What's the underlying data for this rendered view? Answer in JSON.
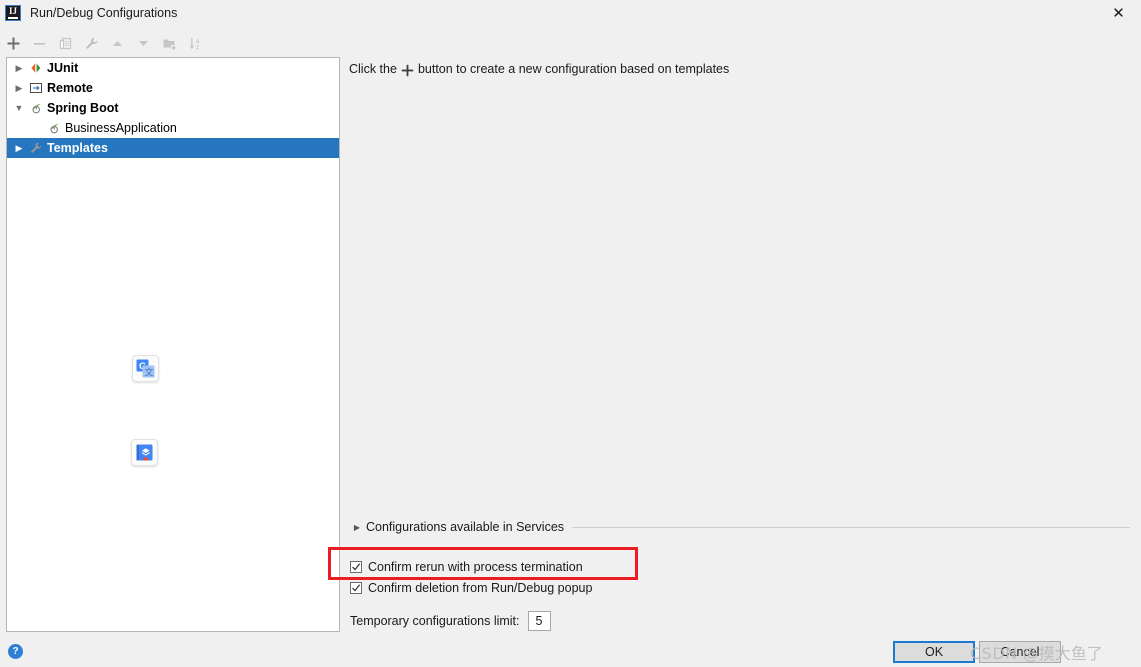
{
  "window": {
    "title": "Run/Debug Configurations",
    "app_icon": "intellij-idea-icon",
    "close_icon": "✕"
  },
  "toolbar": {
    "buttons": [
      {
        "name": "add-configuration-button",
        "icon": "plus-icon",
        "label": "Add New Configuration"
      },
      {
        "name": "remove-configuration-button",
        "icon": "minus-icon",
        "label": "Remove Configuration"
      },
      {
        "name": "copy-configuration-button",
        "icon": "copy-icon",
        "label": "Copy Configuration"
      },
      {
        "name": "edit-templates-button",
        "icon": "wrench-icon",
        "label": "Edit Templates"
      },
      {
        "name": "move-up-button",
        "icon": "arrow-up-icon",
        "label": "Move Up"
      },
      {
        "name": "move-down-button",
        "icon": "arrow-down-icon",
        "label": "Move Down"
      },
      {
        "name": "new-folder-button",
        "icon": "folder-add-icon",
        "label": "Create New Folder"
      },
      {
        "name": "sort-configurations-button",
        "icon": "sort-az-icon",
        "label": "Sort Configurations"
      }
    ]
  },
  "tree": {
    "items": [
      {
        "label": "JUnit",
        "icon": "junit-icon",
        "twisty": "collapsed",
        "bold": true,
        "indent": 0,
        "selected": false
      },
      {
        "label": "Remote",
        "icon": "remote-icon",
        "twisty": "collapsed",
        "bold": true,
        "indent": 0,
        "selected": false
      },
      {
        "label": "Spring Boot",
        "icon": "spring-boot-icon",
        "twisty": "expanded",
        "bold": true,
        "indent": 0,
        "selected": false
      },
      {
        "label": "BusinessApplication",
        "icon": "spring-boot-icon",
        "twisty": "none",
        "bold": false,
        "indent": 1,
        "selected": false
      },
      {
        "label": "Templates",
        "icon": "wrench-icon",
        "twisty": "collapsed",
        "bold": true,
        "indent": 0,
        "selected": true
      }
    ],
    "selection_color": "#2675bf"
  },
  "floating_icons": [
    {
      "name": "google-translate-icon",
      "label": "Google Translate"
    },
    {
      "name": "dictionary-book-icon",
      "label": "Dictionary"
    }
  ],
  "main": {
    "hint_before": "Click the",
    "hint_plus_icon": "plus-icon",
    "hint_after": "button to create a new configuration based on templates",
    "services_section": {
      "label": "Configurations available in Services",
      "expanded": false,
      "arrow_icon": "triangle-right-icon"
    },
    "options": [
      {
        "name": "confirm-rerun-checkbox",
        "label": "Confirm rerun with process termination",
        "checked": true,
        "highlighted": true
      },
      {
        "name": "confirm-deletion-checkbox",
        "label": "Confirm deletion from Run/Debug popup",
        "checked": true,
        "highlighted": false
      }
    ],
    "temp_limit": {
      "label": "Temporary configurations limit:",
      "value": "5"
    },
    "highlight_color": "#ec1c24"
  },
  "footer": {
    "help_label": "?",
    "ok_label": "OK",
    "cancel_label": "Cancel",
    "ok_accent_color": "#1e7ad1"
  },
  "watermark": {
    "brand": "CSDN",
    "handle": "@摸大鱼了"
  }
}
